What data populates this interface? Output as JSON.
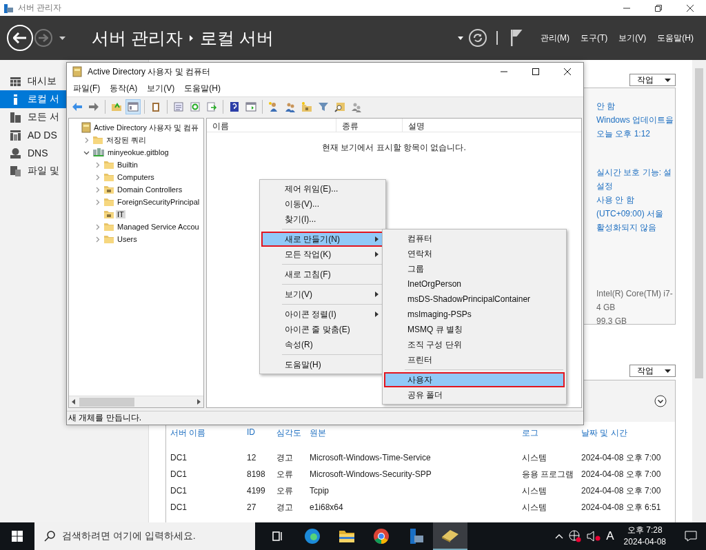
{
  "window": {
    "title": "서버 관리자"
  },
  "header": {
    "breadcrumb": [
      "서버 관리자",
      "로컬 서버"
    ],
    "menu": [
      "관리(M)",
      "도구(T)",
      "보기(V)",
      "도움말(H)"
    ]
  },
  "sidebar": {
    "items": [
      {
        "kind": "dashboard",
        "label": "대시보",
        "selected": false
      },
      {
        "kind": "local",
        "label": "로컬 서",
        "selected": true
      },
      {
        "kind": "all",
        "label": "모든 서",
        "selected": false
      },
      {
        "kind": "adds",
        "label": "AD DS",
        "selected": false
      },
      {
        "kind": "dns",
        "label": "DNS",
        "selected": false
      },
      {
        "kind": "files",
        "label": "파일 및",
        "selected": false
      }
    ]
  },
  "properties": {
    "task_button": "작업",
    "groups": [
      [
        "안 함",
        "Windows 업데이트을",
        "오늘 오후 1:12"
      ],
      [
        "실시간 보호 기능: 설",
        "설정",
        "사용 안 함",
        "(UTC+09:00) 서울",
        "활성화되지 않음"
      ],
      [
        "Intel(R) Core(TM) i7-",
        "4 GB",
        "99.3 GB"
      ]
    ]
  },
  "events": {
    "task_button": "작업",
    "columns": [
      "서버 이름",
      "ID",
      "심각도",
      "원본",
      "로그",
      "날짜 및 시간"
    ],
    "rows": [
      [
        "DC1",
        "12",
        "경고",
        "Microsoft-Windows-Time-Service",
        "시스템",
        "2024-04-08 오후 7:00"
      ],
      [
        "DC1",
        "8198",
        "오류",
        "Microsoft-Windows-Security-SPP",
        "응용 프로그램",
        "2024-04-08 오후 7:00"
      ],
      [
        "DC1",
        "4199",
        "오류",
        "Tcpip",
        "시스템",
        "2024-04-08 오후 7:00"
      ],
      [
        "DC1",
        "27",
        "경고",
        "e1i68x64",
        "시스템",
        "2024-04-08 오후 6:51"
      ]
    ]
  },
  "dialog": {
    "title": "Active Directory 사용자 및 컴퓨터",
    "menu": [
      "파일(F)",
      "동작(A)",
      "보기(V)",
      "도움말(H)"
    ],
    "tree": [
      {
        "kind": "root",
        "label": "Active Directory 사용자 및 컴퓨",
        "selected": false,
        "children": [
          {
            "kind": "folder",
            "label": "저장된 쿼리",
            "expanded": false,
            "selected": false
          },
          {
            "kind": "domain",
            "label": "minyeokue.gitblog",
            "expanded": true,
            "selected": false,
            "children": [
              {
                "kind": "folder",
                "label": "Builtin",
                "expanded": false,
                "selected": false
              },
              {
                "kind": "folder",
                "label": "Computers",
                "expanded": false,
                "selected": false
              },
              {
                "kind": "ou",
                "label": "Domain Controllers",
                "expanded": false,
                "selected": false
              },
              {
                "kind": "folder",
                "label": "ForeignSecurityPrincipal",
                "expanded": false,
                "selected": false
              },
              {
                "kind": "ou",
                "label": "IT",
                "selected": true
              },
              {
                "kind": "folder",
                "label": "Managed Service Accou",
                "expanded": false,
                "selected": false
              },
              {
                "kind": "folder",
                "label": "Users",
                "expanded": false,
                "selected": false
              }
            ]
          }
        ]
      }
    ],
    "list": {
      "columns": [
        "이름",
        "종류",
        "설명"
      ],
      "empty_message": "현재 보기에서 표시할 항목이 없습니다."
    },
    "status": "새 개체를 만듭니다."
  },
  "context_menu": {
    "items": [
      {
        "kind": "item",
        "label": "제어 위임(E)...",
        "submenu": false,
        "selected": false
      },
      {
        "kind": "item",
        "label": "이동(V)...",
        "submenu": false,
        "selected": false
      },
      {
        "kind": "item",
        "label": "찾기(I)...",
        "submenu": false,
        "selected": false
      },
      {
        "kind": "separator"
      },
      {
        "kind": "item",
        "label": "새로 만들기(N)",
        "submenu": true,
        "selected": true
      },
      {
        "kind": "item",
        "label": "모든 작업(K)",
        "submenu": true,
        "selected": false
      },
      {
        "kind": "separator"
      },
      {
        "kind": "item",
        "label": "새로 고침(F)",
        "submenu": false,
        "selected": false
      },
      {
        "kind": "separator"
      },
      {
        "kind": "item",
        "label": "보기(V)",
        "submenu": true,
        "selected": false
      },
      {
        "kind": "separator"
      },
      {
        "kind": "item",
        "label": "아이콘 정렬(I)",
        "submenu": true,
        "selected": false
      },
      {
        "kind": "item",
        "label": "아이콘 줄 맞춤(E)",
        "submenu": false,
        "selected": false
      },
      {
        "kind": "item",
        "label": "속성(R)",
        "submenu": false,
        "selected": false
      },
      {
        "kind": "separator"
      },
      {
        "kind": "item",
        "label": "도움말(H)",
        "submenu": false,
        "selected": false
      }
    ]
  },
  "submenu": {
    "items": [
      {
        "kind": "item",
        "label": "컴퓨터",
        "selected": false
      },
      {
        "kind": "item",
        "label": "연락처",
        "selected": false
      },
      {
        "kind": "item",
        "label": "그룹",
        "selected": false
      },
      {
        "kind": "item",
        "label": "InetOrgPerson",
        "selected": false
      },
      {
        "kind": "item",
        "label": "msDS-ShadowPrincipalContainer",
        "selected": false
      },
      {
        "kind": "item",
        "label": "msImaging-PSPs",
        "selected": false
      },
      {
        "kind": "item",
        "label": "MSMQ 큐 별칭",
        "selected": false
      },
      {
        "kind": "item",
        "label": "조직 구성 단위",
        "selected": false
      },
      {
        "kind": "item",
        "label": "프린터",
        "selected": false
      },
      {
        "kind": "separator"
      },
      {
        "kind": "item",
        "label": "사용자",
        "selected": true
      },
      {
        "kind": "item",
        "label": "공유 폴더",
        "selected": false
      }
    ]
  },
  "taskbar": {
    "search_placeholder": "검색하려면 여기에 입력하세요.",
    "ime": "A",
    "time": "오후 7:28",
    "date": "2024-04-08"
  }
}
